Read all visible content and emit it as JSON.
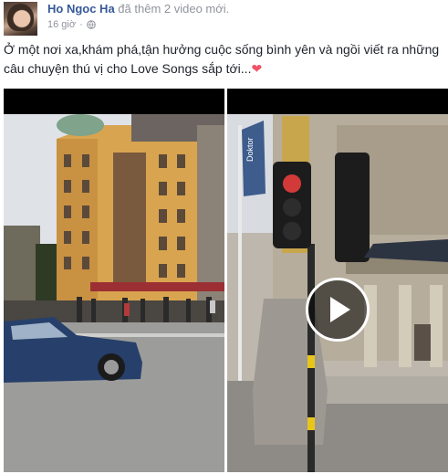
{
  "post": {
    "author": "Ho Ngoc Ha",
    "action": "đã thêm 2 video mới.",
    "time": "16 giờ",
    "privacy_icon": "globe-icon",
    "caption": "Ở một nơi xa,khám phá,tận hưởng cuộc sống bình yên và ngồi viết ra những câu chuyện thú vị cho Love Songs sắp tới...",
    "caption_emoji": "❤"
  },
  "videos": [
    {
      "name": "video-left",
      "scene": "street-corner-yellow-building"
    },
    {
      "name": "video-right",
      "scene": "traffic-light-theatre",
      "overlay_icon": "play-icon",
      "sign_text": "Doktor"
    }
  ]
}
